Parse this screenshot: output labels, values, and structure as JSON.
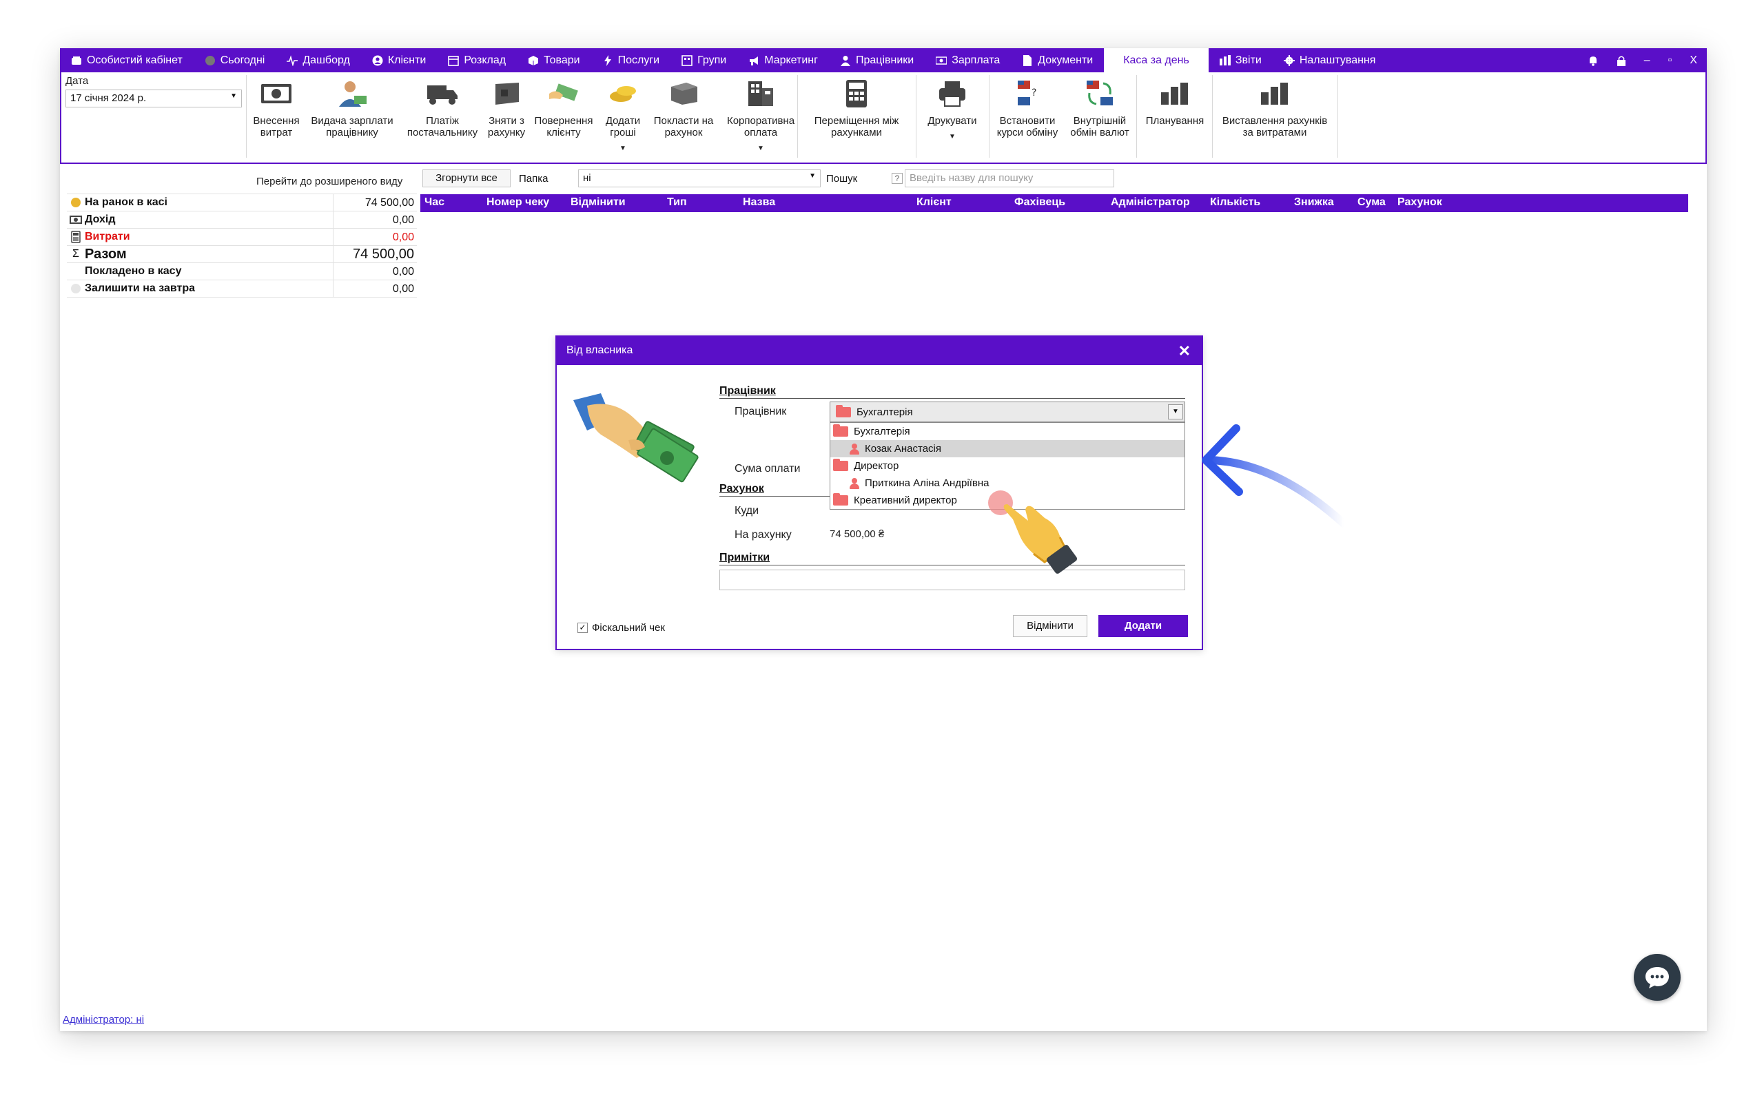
{
  "nav": {
    "items": [
      {
        "label": "Особистий кабінет",
        "icon": "wallet-icon"
      },
      {
        "label": "Сьогодні",
        "icon": "dot-icon"
      },
      {
        "label": "Дашборд",
        "icon": "pulse-icon"
      },
      {
        "label": "Клієнти",
        "icon": "user-icon"
      },
      {
        "label": "Розклад",
        "icon": "calendar-icon"
      },
      {
        "label": "Товари",
        "icon": "box-icon"
      },
      {
        "label": "Послуги",
        "icon": "bolt-icon"
      },
      {
        "label": "Групи",
        "icon": "group-icon"
      },
      {
        "label": "Маркетинг",
        "icon": "megaphone-icon"
      },
      {
        "label": "Працівники",
        "icon": "person-icon"
      },
      {
        "label": "Зарплата",
        "icon": "money-icon"
      },
      {
        "label": "Документи",
        "icon": "document-icon"
      },
      {
        "label": "Каса за день",
        "icon": ""
      },
      {
        "label": "Звіти",
        "icon": "bars-icon"
      },
      {
        "label": "Налаштування",
        "icon": "gear-icon"
      }
    ],
    "active": "Каса за день",
    "window_minimize": "–",
    "window_restore": "▫",
    "window_close": "X"
  },
  "ribbon": {
    "date_label": "Дата",
    "date_value": "17 січня 2024 р.",
    "buttons": [
      {
        "label": "Внесення\nвитрат"
      },
      {
        "label": "Видача зарплати\nпрацівнику"
      },
      {
        "label": "Платіж\nпостачальнику"
      },
      {
        "label": "Зняти з\nрахунку"
      },
      {
        "label": "Повернення\nклієнту"
      },
      {
        "label": "Додати\nгроші"
      },
      {
        "label": "Покласти на\nрахунок"
      },
      {
        "label": "Корпоративна\nоплата"
      },
      {
        "label": "Переміщення між\nрахунками"
      },
      {
        "label": "Друкувати"
      },
      {
        "label": "Встановити\nкурси обміну"
      },
      {
        "label": "Внутрішній\nобмін валют"
      },
      {
        "label": "Планування"
      },
      {
        "label": "Виставлення рахунків\nза витратами"
      }
    ]
  },
  "summary": {
    "link": "Перейти до розширеного виду",
    "rows": [
      {
        "label": "На ранок в касі",
        "value": "74 500,00"
      },
      {
        "label": "Дохід",
        "value": "0,00"
      },
      {
        "label": "Витрати",
        "value": "0,00"
      },
      {
        "label": "Разом",
        "value": "74 500,00"
      },
      {
        "label": "Покладено в касу",
        "value": "0,00"
      },
      {
        "label": "Залишити на завтра",
        "value": "0,00"
      }
    ]
  },
  "toolbar": {
    "collapse_all": "Згорнути все",
    "folder_label": "Папка",
    "folder_value": "ні",
    "search_label": "Пошук",
    "search_help": "?",
    "search_placeholder": "Введіть назву для пошуку"
  },
  "grid": {
    "columns": [
      "Час",
      "Номер чеку",
      "Відмінити",
      "Тип",
      "Назва",
      "Клієнт",
      "Фахівець",
      "Адміністратор",
      "Кількість",
      "Знижка",
      "Сума",
      "Рахунок"
    ]
  },
  "footer": {
    "admin_link": "Адміністратор: ні"
  },
  "dialog": {
    "title": "Від власника",
    "close": "✕",
    "section_employee": "Працівник",
    "employee_label": "Працівник",
    "employee_value": "Бухгалтерія",
    "dropdown_items": [
      {
        "label": "Бухгалтерія",
        "kind": "folder"
      },
      {
        "label": "Козак Анастасія",
        "kind": "person"
      },
      {
        "label": "Директор",
        "kind": "folder"
      },
      {
        "label": "Приткина Аліна Андріївна",
        "kind": "person"
      },
      {
        "label": "Креативний директор",
        "kind": "folder"
      }
    ],
    "payment_sum_label": "Сума оплати",
    "section_account": "Рахунок",
    "where_label": "Куди",
    "on_account_label": "На рахунку",
    "on_account_value": "74 500,00 ₴",
    "section_notes": "Примітки",
    "fiscal_label": "Фіскальний чек",
    "fiscal_check": "✓",
    "cancel": "Відмінити",
    "add": "Додати"
  },
  "colors": {
    "accent": "#5a0fc8",
    "expense_red": "#e01010",
    "arrow_blue": "#2f56e8"
  }
}
